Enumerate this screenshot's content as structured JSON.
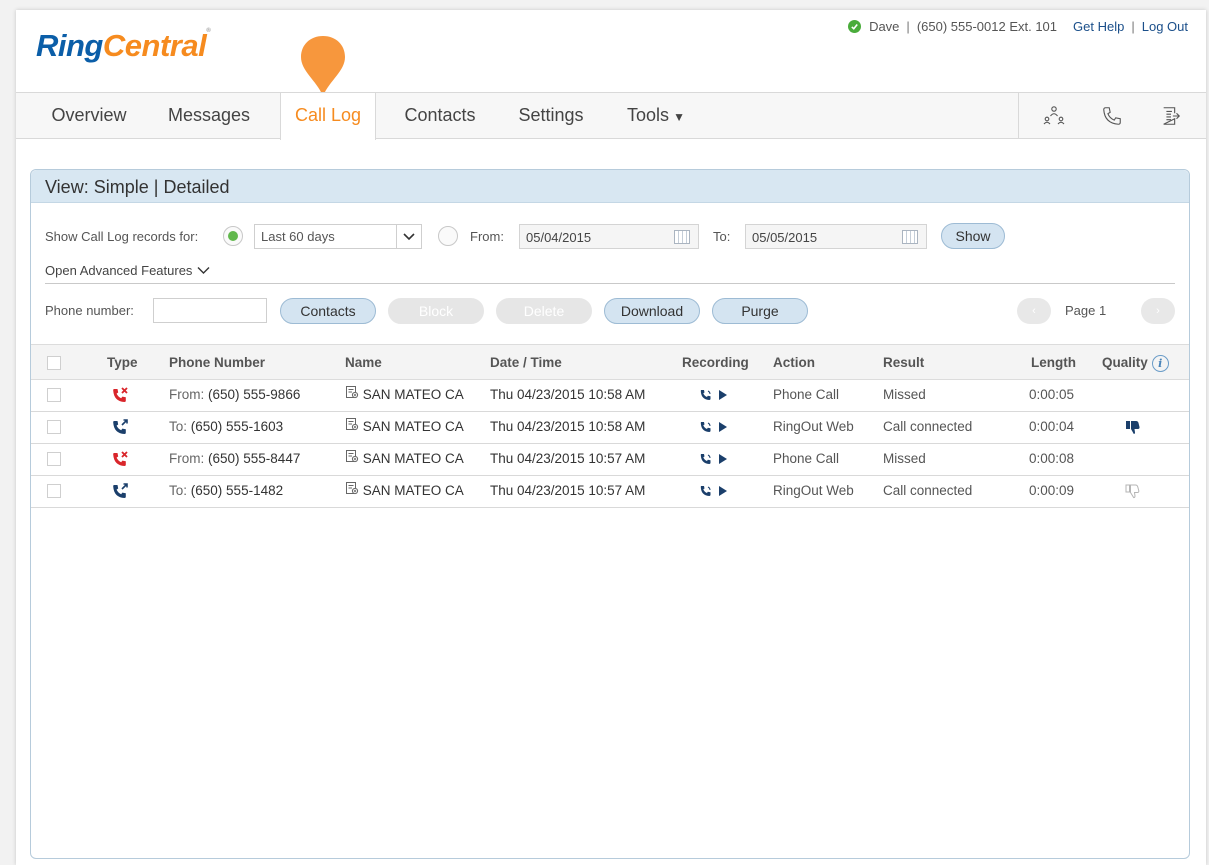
{
  "brand": {
    "ring": "Ring",
    "central": "Central"
  },
  "user": {
    "name": "Dave",
    "phone": "(650) 555-0012 Ext. 101",
    "get_help": "Get Help",
    "log_out": "Log Out",
    "status_color": "#4aac3b"
  },
  "nav": {
    "items": [
      {
        "label": "Overview"
      },
      {
        "label": "Messages"
      },
      {
        "label": "Call Log",
        "active": true
      },
      {
        "label": "Contacts"
      },
      {
        "label": "Settings"
      },
      {
        "label": "Tools"
      }
    ],
    "icons": [
      "users-icon",
      "phone-icon",
      "fax-icon"
    ]
  },
  "panel": {
    "view_label": "View:",
    "view_simple": "Simple",
    "view_detailed": "Detailed",
    "filter": {
      "label": "Show Call Log records for:",
      "period": "Last 60 days",
      "from_label": "From:",
      "from": "05/04/2015",
      "to_label": "To:",
      "to": "05/05/2015",
      "show": "Show"
    },
    "advanced": "Open Advanced Features",
    "toolbar": {
      "phone_label": "Phone number:",
      "phone_value": "",
      "contacts": "Contacts",
      "block": "Block",
      "delete": "Delete",
      "download": "Download",
      "purge": "Purge",
      "page": "Page 1"
    }
  },
  "table": {
    "headers": {
      "type": "Type",
      "phone": "Phone Number",
      "name": "Name",
      "date": "Date / Time",
      "recording": "Recording",
      "action": "Action",
      "result": "Result",
      "length": "Length",
      "quality": "Quality"
    },
    "rows": [
      {
        "dir": "From:",
        "number": "(650) 555-9866",
        "name": "SAN MATEO CA",
        "date": "Thu 04/23/2015 10:58 AM",
        "action": "Phone Call",
        "result": "Missed",
        "length": "0:00:05",
        "missed": true,
        "quality": ""
      },
      {
        "dir": "To:",
        "number": "(650) 555-1603",
        "name": "SAN MATEO CA",
        "date": "Thu 04/23/2015 10:58 AM",
        "action": "RingOut Web",
        "result": "Call connected",
        "length": "0:00:04",
        "missed": false,
        "quality": "thumbs-down"
      },
      {
        "dir": "From:",
        "number": "(650) 555-8447",
        "name": "SAN MATEO CA",
        "date": "Thu 04/23/2015 10:57 AM",
        "action": "Phone Call",
        "result": "Missed",
        "length": "0:00:08",
        "missed": true,
        "quality": ""
      },
      {
        "dir": "To:",
        "number": "(650) 555-1482",
        "name": "SAN MATEO CA",
        "date": "Thu 04/23/2015 10:57 AM",
        "action": "RingOut Web",
        "result": "Call connected",
        "length": "0:00:09",
        "missed": false,
        "quality": "thumbs-outline"
      }
    ]
  },
  "colors": {
    "accent": "#f68b1f",
    "brand_blue": "#0b5ea8",
    "missed": "#d9262b",
    "outgoing": "#1b3f6b"
  }
}
